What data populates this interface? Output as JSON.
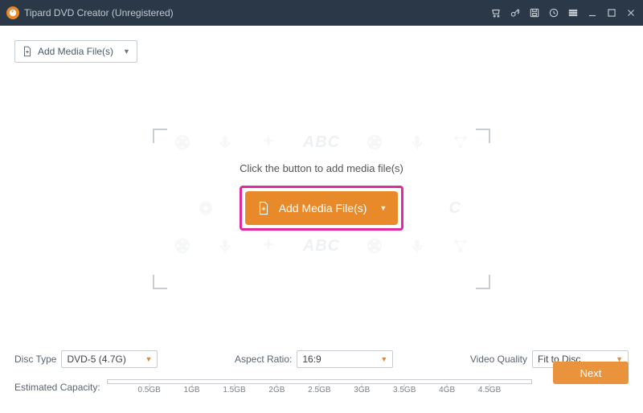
{
  "header": {
    "title": "Tipard DVD Creator (Unregistered)"
  },
  "toolbar": {
    "add_media_label": "Add Media File(s)"
  },
  "main": {
    "hint": "Click the button to add media file(s)",
    "add_media_label": "Add Media File(s)",
    "watermark_text": "ABC"
  },
  "footer": {
    "disc_type_label": "Disc Type",
    "disc_type_value": "DVD-5 (4.7G)",
    "aspect_ratio_label": "Aspect Ratio:",
    "aspect_ratio_value": "16:9",
    "video_quality_label": "Video Quality",
    "video_quality_value": "Fit to Disc",
    "estimated_capacity_label": "Estimated Capacity:",
    "ticks": [
      "0.5GB",
      "1GB",
      "1.5GB",
      "2GB",
      "2.5GB",
      "3GB",
      "3.5GB",
      "4GB",
      "4.5GB"
    ],
    "next_label": "Next"
  }
}
